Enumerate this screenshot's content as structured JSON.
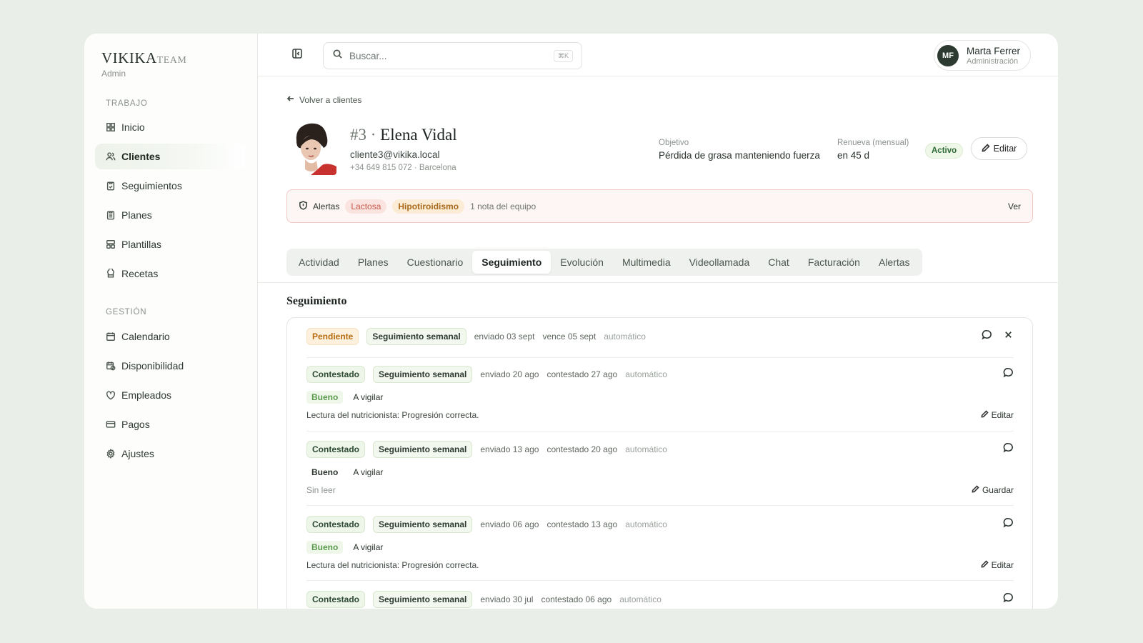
{
  "brand": {
    "name": "VIKIKA",
    "suffix": "TEAM",
    "role": "Admin"
  },
  "sidebar": {
    "sections": [
      {
        "title": "TRABAJO",
        "items": [
          {
            "label": "Inicio",
            "icon": "grid-icon"
          },
          {
            "label": "Clientes",
            "icon": "users-icon",
            "active": true
          },
          {
            "label": "Seguimientos",
            "icon": "clipboard-check-icon"
          },
          {
            "label": "Planes",
            "icon": "clipboard-icon"
          },
          {
            "label": "Plantillas",
            "icon": "templates-icon"
          },
          {
            "label": "Recetas",
            "icon": "chef-hat-icon"
          }
        ]
      },
      {
        "title": "GESTIÓN",
        "items": [
          {
            "label": "Calendario",
            "icon": "calendar-icon"
          },
          {
            "label": "Disponibilidad",
            "icon": "calendar-clock-icon"
          },
          {
            "label": "Empleados",
            "icon": "employees-icon"
          },
          {
            "label": "Pagos",
            "icon": "credit-card-icon"
          },
          {
            "label": "Ajustes",
            "icon": "gear-icon"
          }
        ]
      }
    ]
  },
  "topbar": {
    "search_placeholder": "Buscar...",
    "search_shortcut": "⌘K",
    "user": {
      "initials": "MF",
      "name": "Marta Ferrer",
      "role": "Administración"
    }
  },
  "client": {
    "back_label": "Volver a clientes",
    "number": "#3",
    "separator": "·",
    "name": "Elena Vidal",
    "email": "cliente3@vikika.local",
    "meta": "+34 649 815 072 · Barcelona",
    "objective_label": "Objetivo",
    "objective_value": "Pérdida de grasa manteniendo fuerza",
    "renew_label": "Renueva (mensual)",
    "renew_value": "en 45 d",
    "status": "Activo",
    "edit_label": "Editar"
  },
  "alerts": {
    "label": "Alertas",
    "chips": [
      "Lactosa",
      "Hipotiroidismo"
    ],
    "note": "1 nota del equipo",
    "action": "Ver"
  },
  "tabs": [
    "Actividad",
    "Planes",
    "Cuestionario",
    "Seguimiento",
    "Evolución",
    "Multimedia",
    "Videollamada",
    "Chat",
    "Facturación",
    "Alertas"
  ],
  "active_tab": "Seguimiento",
  "section_title": "Seguimiento",
  "checkins": [
    {
      "status": "Pendiente",
      "type": "Seguimiento semanal",
      "sent": "enviado 03 sept",
      "second": "vence 05 sept",
      "mode": "automático"
    },
    {
      "status": "Contestado",
      "type": "Seguimiento semanal",
      "sent": "enviado 20 ago",
      "second": "contestado 27 ago",
      "mode": "automático",
      "rating": "Bueno",
      "flag": "A vigilar",
      "note": "Lectura del nutricionista: Progresión correcta.",
      "action": "Editar"
    },
    {
      "status": "Contestado",
      "type": "Seguimiento semanal",
      "sent": "enviado 13 ago",
      "second": "contestado 20 ago",
      "mode": "automático",
      "rating": "Bueno",
      "flag": "A vigilar",
      "note": "Sin leer",
      "action": "Guardar"
    },
    {
      "status": "Contestado",
      "type": "Seguimiento semanal",
      "sent": "enviado 06 ago",
      "second": "contestado 13 ago",
      "mode": "automático",
      "rating": "Bueno",
      "flag": "A vigilar",
      "note": "Lectura del nutricionista: Progresión correcta.",
      "action": "Editar"
    },
    {
      "status": "Contestado",
      "type": "Seguimiento semanal",
      "sent": "enviado 30 jul",
      "second": "contestado 06 ago",
      "mode": "automático"
    }
  ],
  "colors": {
    "accent": "#2c3a31",
    "alert_border": "#f0c9c4",
    "pending": "#b76c12",
    "good": "#5a9a4d"
  }
}
